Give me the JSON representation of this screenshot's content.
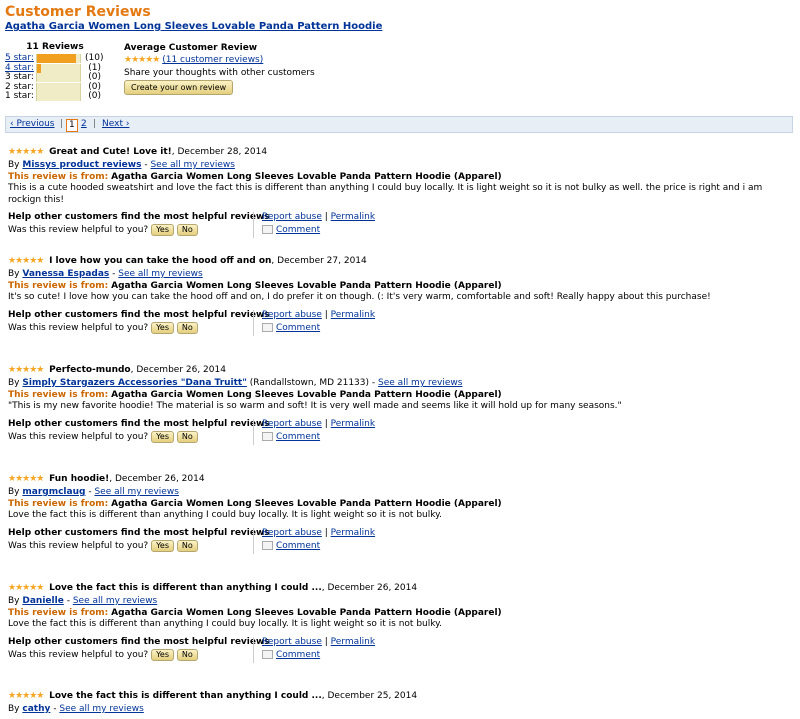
{
  "header": {
    "title": "Customer Reviews",
    "product": "Agatha Garcia Women Long Sleeves Lovable Panda Pattern Hoodie"
  },
  "summary": {
    "heading": "11 Reviews",
    "rows": [
      {
        "label": "5 star:",
        "count": "(10)",
        "fraction": 0.91
      },
      {
        "label": "4 star:",
        "count": "(1)",
        "fraction": 0.09
      },
      {
        "label": "3 star:",
        "count": "(0)",
        "fraction": 0
      },
      {
        "label": "2 star:",
        "count": "(0)",
        "fraction": 0
      },
      {
        "label": "1 star:",
        "count": "(0)",
        "fraction": 0
      }
    ]
  },
  "average": {
    "heading": "Average Customer Review",
    "stars": "★★★★★",
    "link": "(11 customer reviews)",
    "share": "Share your thoughts with other customers",
    "button": "Create your own review"
  },
  "pager": {
    "prev": "‹ Previous",
    "sep1": "|",
    "page1": "1",
    "page2": "2",
    "sep2": "|",
    "next": "Next ›"
  },
  "common": {
    "by": "By",
    "see_all": "See all my reviews",
    "from_label": "This review is from:",
    "from_product": "Agatha Garcia Women Long Sleeves Lovable Panda Pattern Hoodie (Apparel)",
    "help_text": "Help other customers find the most helpful reviews",
    "helpful_q": "Was this review helpful to you?",
    "yes": "Yes",
    "no": "No",
    "report": "Report abuse",
    "sep": "|",
    "permalink": "Permalink",
    "comment": "Comment",
    "stars": "★★★★★"
  },
  "reviews": [
    {
      "title": "Great and Cute! Love it!",
      "date": ", December 28, 2014",
      "author": "Missys product reviews",
      "location": "",
      "dash": "-",
      "body": "This is a cute hooded sweatshirt and love the fact this is different than anything I could buy locally. It is light weight so it is not bulky as well. the price is right and i am rockign this!"
    },
    {
      "title": "I love how you can take the hood off and on",
      "date": ", December 27, 2014",
      "author": "Vanessa Espadas",
      "location": "",
      "dash": "-",
      "body": "It's so cute! I love how you can take the hood off and on, I do prefer it on though. (: It's very warm, comfortable and soft! Really happy about this purchase!"
    },
    {
      "title": "Perfecto-mundo",
      "date": ", December 26, 2014",
      "author": "Simply Stargazers Accessories \"Dana Truitt\"",
      "location": "(Randallstown, MD 21133)",
      "dash": "-",
      "body": "\"This is my new favorite hoodie! The material is so warm and soft! It is very well made and seems like it will hold up for many seasons.\""
    },
    {
      "title": "Fun hoodie!",
      "date": ", December 26, 2014",
      "author": "margmclaug",
      "location": "",
      "dash": "-",
      "body": "Love the fact this is different than anything I could buy locally. It is light weight so it is not bulky."
    },
    {
      "title": "Love the fact this is different than anything I could ...",
      "date": ", December 26, 2014",
      "author": "Danielle",
      "location": "",
      "dash": "-",
      "body": "Love the fact this is different than anything I could buy locally. It is light weight so it is not bulky."
    },
    {
      "title": "Love the fact this is different than anything I could ...",
      "date": ", December 25, 2014",
      "author": "cathy",
      "location": "",
      "dash": "-",
      "body": ""
    }
  ]
}
